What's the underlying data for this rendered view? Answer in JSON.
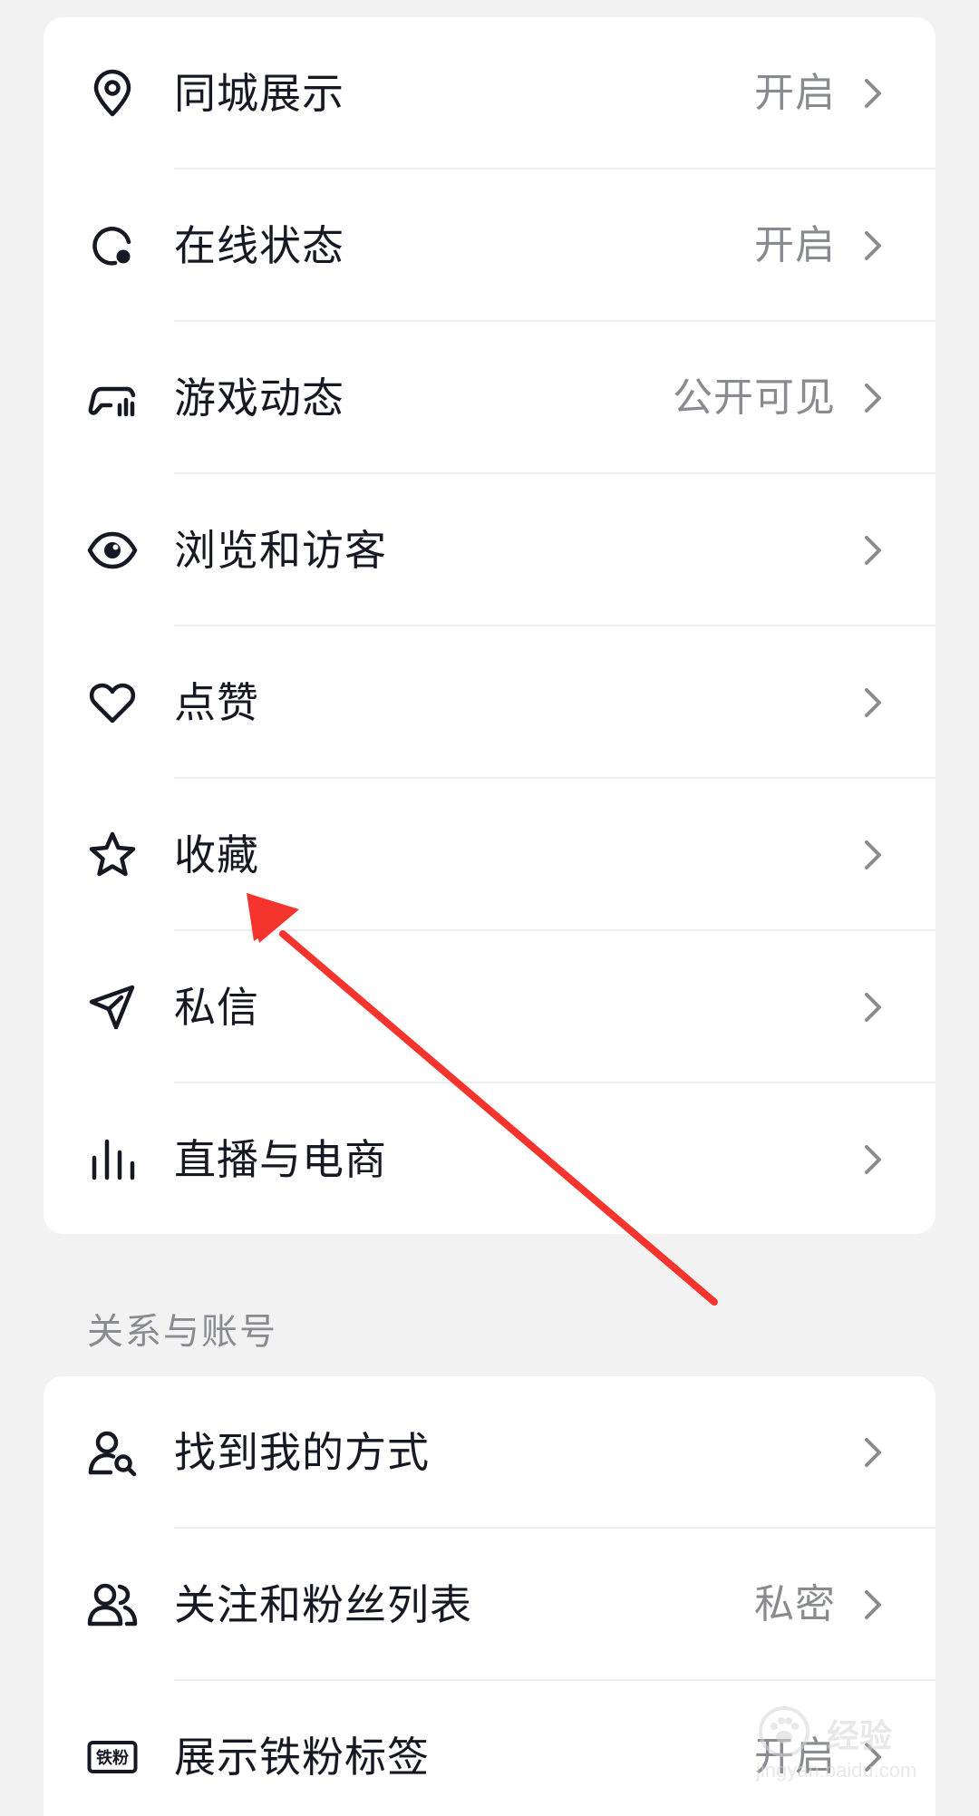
{
  "privacy_rows": [
    {
      "label": "同城展示",
      "value": "开启",
      "icon": "location-pin-icon"
    },
    {
      "label": "在线状态",
      "value": "开启",
      "icon": "online-status-icon"
    },
    {
      "label": "游戏动态",
      "value": "公开可见",
      "icon": "game-controller-icon"
    },
    {
      "label": "浏览和访客",
      "value": "",
      "icon": "eye-icon"
    },
    {
      "label": "点赞",
      "value": "",
      "icon": "heart-icon"
    },
    {
      "label": "收藏",
      "value": "",
      "icon": "star-icon"
    },
    {
      "label": "私信",
      "value": "",
      "icon": "paper-plane-icon"
    },
    {
      "label": "直播与电商",
      "value": "",
      "icon": "bar-chart-icon"
    }
  ],
  "section_relationships": {
    "title": "关系与账号",
    "rows": [
      {
        "label": "找到我的方式",
        "value": "",
        "icon": "user-search-icon"
      },
      {
        "label": "关注和粉丝列表",
        "value": "私密",
        "icon": "users-icon"
      },
      {
        "label": "展示铁粉标签",
        "value": "开启",
        "icon": "fan-badge-icon",
        "badge_text": "铁粉"
      }
    ]
  },
  "annotation": {
    "type": "red-arrow",
    "points_to": "收藏",
    "color": "#f5342e"
  },
  "watermark": {
    "main": "经验",
    "sub": "jingyan.baidu.com"
  },
  "colors": {
    "background": "#f2f2f2",
    "card": "#ffffff",
    "text": "#161823",
    "secondary": "#8a8b91",
    "annotation": "#f5342e"
  }
}
